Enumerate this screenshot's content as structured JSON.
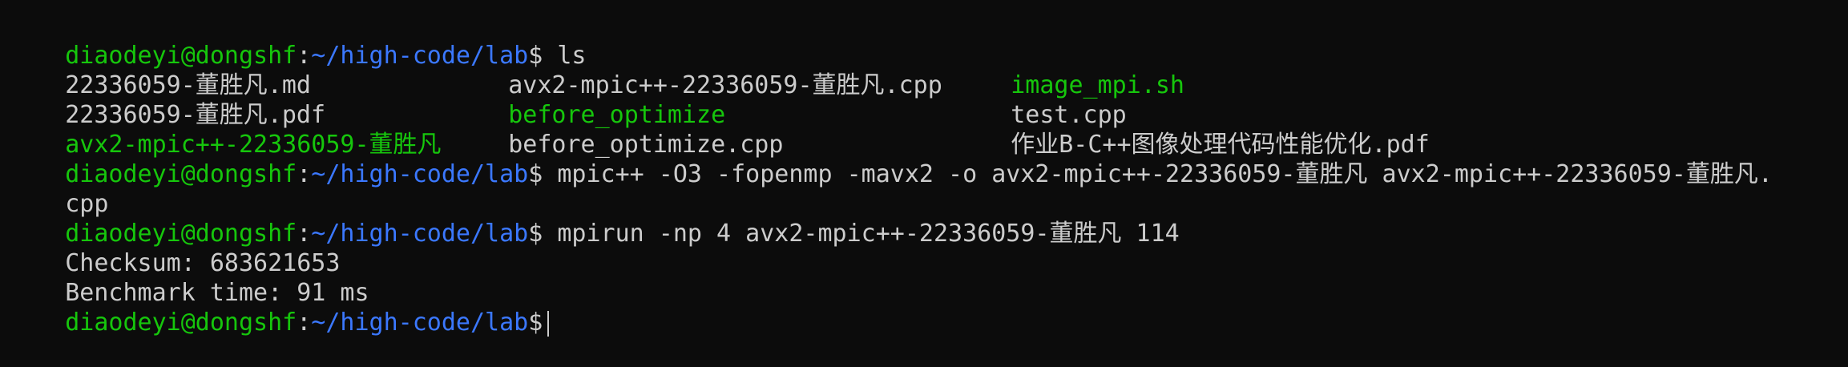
{
  "window": {
    "background": "#0c0c0c",
    "foreground": "#cccccc",
    "colors": {
      "user_host": "#16c60c",
      "path": "#3b78ff",
      "executable": "#16c60c"
    }
  },
  "prompt": {
    "user_host": "diaodeyi@dongshf",
    "separator": ":",
    "path": "~/high-code/lab",
    "symbol": "$"
  },
  "commands": {
    "ls": "ls",
    "compile": "mpic++ -O3 -fopenmp -mavx2 -o avx2-mpic++-22336059-董胜凡 avx2-mpic++-22336059-董胜凡.",
    "compile_wrap": "cpp",
    "run": "mpirun -np 4 avx2-mpic++-22336059-董胜凡 114"
  },
  "ls_output": {
    "rows": [
      [
        {
          "name": "22336059-董胜凡.md",
          "type": "file"
        },
        {
          "name": "avx2-mpic++-22336059-董胜凡.cpp",
          "type": "file"
        },
        {
          "name": "image_mpi.sh",
          "type": "executable"
        }
      ],
      [
        {
          "name": "22336059-董胜凡.pdf",
          "type": "file"
        },
        {
          "name": "before_optimize",
          "type": "executable"
        },
        {
          "name": "test.cpp",
          "type": "file"
        }
      ],
      [
        {
          "name": "avx2-mpic++-22336059-董胜凡",
          "type": "executable"
        },
        {
          "name": "before_optimize.cpp",
          "type": "file"
        },
        {
          "name": "作业B-C++图像处理代码性能优化.pdf",
          "type": "file"
        }
      ]
    ]
  },
  "run_output": {
    "checksum": "Checksum: 683621653",
    "benchmark": "Benchmark time: 91 ms"
  }
}
